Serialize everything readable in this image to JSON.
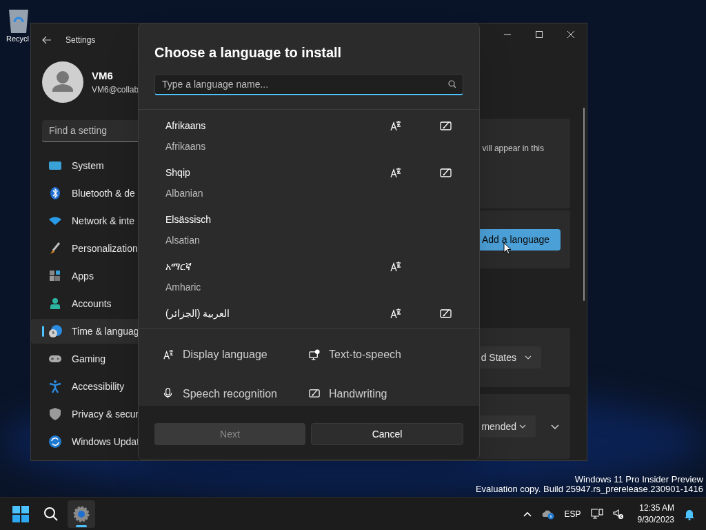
{
  "desktop": {
    "recycle_bin_label": "Recycl"
  },
  "settings_window": {
    "title": "Settings",
    "user": {
      "name": "VM6",
      "email": "VM6@collab"
    },
    "search": {
      "placeholder": "Find a setting"
    },
    "nav": [
      {
        "label": "System",
        "kind": "system",
        "selected": false
      },
      {
        "label": "Bluetooth & de",
        "kind": "bluetooth",
        "selected": false
      },
      {
        "label": "Network & inte",
        "kind": "network",
        "selected": false
      },
      {
        "label": "Personalization",
        "kind": "brush",
        "selected": false
      },
      {
        "label": "Apps",
        "kind": "apps",
        "selected": false
      },
      {
        "label": "Accounts",
        "kind": "accounts",
        "selected": false
      },
      {
        "label": "Time & languag",
        "kind": "time",
        "selected": true
      },
      {
        "label": "Gaming",
        "kind": "gaming",
        "selected": false
      },
      {
        "label": "Accessibility",
        "kind": "accessibility",
        "selected": false
      },
      {
        "label": "Privacy & secur",
        "kind": "shield",
        "selected": false
      },
      {
        "label": "Windows Updat",
        "kind": "update",
        "selected": false
      }
    ],
    "content": {
      "card_text": "vill appear in this",
      "add_button": "Add a language",
      "region_dropdown": "d States",
      "format_dropdown": "mended"
    }
  },
  "dialog": {
    "title": "Choose a language to install",
    "search": {
      "placeholder": "Type a language name..."
    },
    "languages": [
      {
        "name": "Afrikaans",
        "english": "Afrikaans",
        "display_language": true,
        "handwriting": true
      },
      {
        "name": "Shqip",
        "english": "Albanian",
        "display_language": true,
        "handwriting": true
      },
      {
        "name": "Elsässisch",
        "english": "Alsatian",
        "display_language": false,
        "handwriting": false
      },
      {
        "name": "አማርኛ",
        "english": "Amharic",
        "display_language": true,
        "handwriting": false
      },
      {
        "name": "العربية (الجزائر)",
        "display_language": true,
        "handwriting": true
      }
    ],
    "legend": [
      {
        "kind": "display",
        "label": "Display language"
      },
      {
        "kind": "tts",
        "label": "Text-to-speech"
      },
      {
        "kind": "speech",
        "label": "Speech recognition"
      },
      {
        "kind": "handwriting",
        "label": "Handwriting"
      }
    ],
    "buttons": [
      {
        "label": "Next",
        "disabled": true
      },
      {
        "label": "Cancel",
        "disabled": false
      }
    ]
  },
  "watermark": [
    "Windows 11 Pro Insider Preview",
    "Evaluation copy. Build 25947.rs_prerelease.230901-1416"
  ],
  "taskbar": {
    "language": "ESP",
    "time": "12:35 AM",
    "date": "9/30/2023"
  }
}
